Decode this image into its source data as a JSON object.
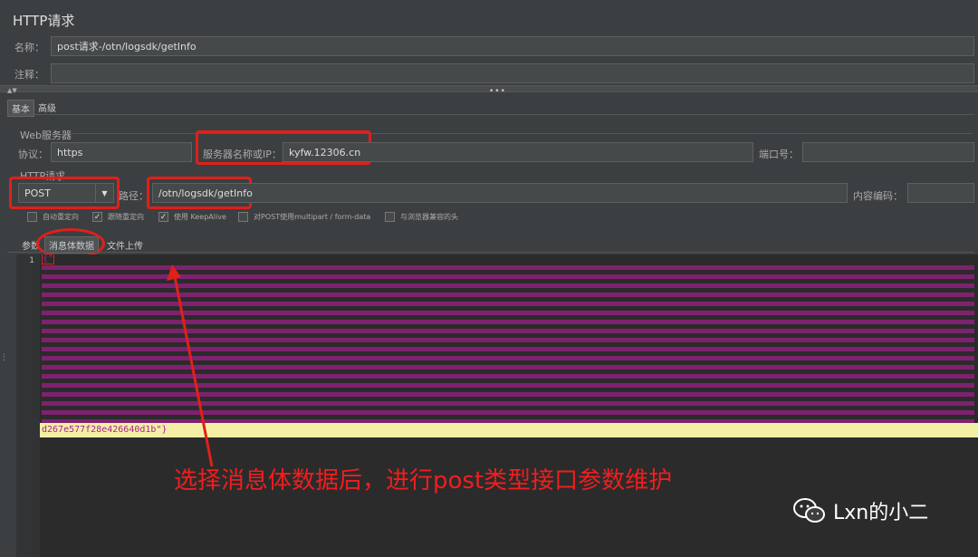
{
  "panel": {
    "title": "HTTP请求"
  },
  "name": {
    "label": "名称：",
    "value": "post请求-/otn/logsdk/getInfo"
  },
  "comment": {
    "label": "注释：",
    "value": ""
  },
  "tabs": [
    {
      "label": "基本"
    },
    {
      "label": "高级"
    }
  ],
  "web_server": {
    "section": "Web服务器",
    "protocol_label": "协议：",
    "protocol_value": "https",
    "server_label": "服务器名称或IP：",
    "server_value": "kyfw.12306.cn",
    "port_label": "端口号：",
    "port_value": ""
  },
  "http_request": {
    "section": "HTTP请求",
    "method": "POST",
    "path_label": "路径：",
    "path_value": "/otn/logsdk/getInfo",
    "encoding_label": "内容编码：",
    "encoding_value": ""
  },
  "options": [
    {
      "label": "自动重定向",
      "checked": false
    },
    {
      "label": "跟随重定向",
      "checked": true
    },
    {
      "label": "使用 KeepAlive",
      "checked": true
    },
    {
      "label": "对POST使用multipart / form-data",
      "checked": false
    },
    {
      "label": "与浏览器兼容的头",
      "checked": false
    }
  ],
  "subtabs": [
    {
      "label": "参数"
    },
    {
      "label": "消息体数据"
    },
    {
      "label": "文件上传"
    }
  ],
  "editor": {
    "line_number": "1",
    "body_start": "{\"",
    "body_end": "d267e577f28e426640d1b\"}"
  },
  "annotation": "选择消息体数据后，进行post类型接口参数维护",
  "watermark": "Lxn的小二",
  "colors": {
    "highlight": "#e0201a",
    "code": "#b0209a",
    "current_line": "#f3f0a5"
  }
}
